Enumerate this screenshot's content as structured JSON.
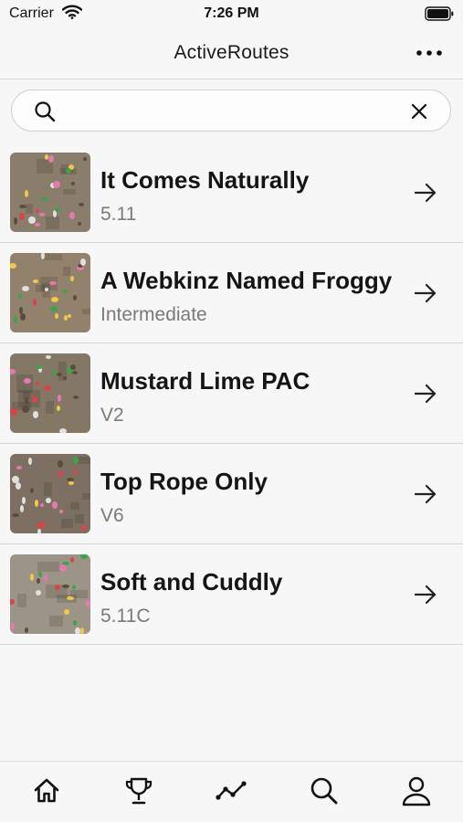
{
  "status_bar": {
    "carrier": "Carrier",
    "time": "7:26 PM"
  },
  "nav": {
    "title": "ActiveRoutes",
    "more_icon": "ellipsis-icon"
  },
  "search": {
    "value": "",
    "placeholder": ""
  },
  "routes": [
    {
      "name": "It Comes Naturally",
      "grade": "5.11",
      "thumb_base": "#8a7d6c"
    },
    {
      "name": "A Webkinz Named Froggy",
      "grade": "Intermediate",
      "thumb_base": "#92826d"
    },
    {
      "name": "Mustard Lime PAC",
      "grade": "V2",
      "thumb_base": "#857766"
    },
    {
      "name": "Top Rope Only",
      "grade": "V6",
      "thumb_base": "#7d7062"
    },
    {
      "name": "Soft and Cuddly",
      "grade": "5.11C",
      "thumb_base": "#9c9486"
    }
  ],
  "tabs": [
    "home-icon",
    "trophy-icon",
    "activity-chart-icon",
    "search-icon",
    "profile-icon"
  ],
  "colors": {
    "hold_red": "#d8444a",
    "hold_green": "#3fa24a",
    "hold_pink": "#e47ab0",
    "text_secondary": "#7a7a7a"
  }
}
